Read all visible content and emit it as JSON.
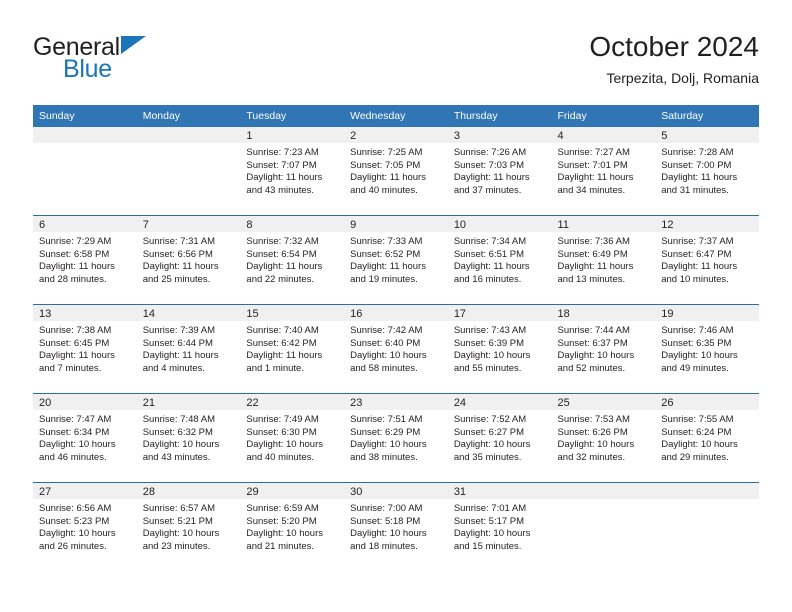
{
  "logo": {
    "word_top": "General",
    "word_bottom": "Blue",
    "accent_color": "#1b75bb"
  },
  "header": {
    "title": "October 2024",
    "subtitle": "Terpezita, Dolj, Romania"
  },
  "colors": {
    "header_band": "#3075b4",
    "row_divider": "#2e6da4",
    "daynum_band": "#f0f0f0",
    "text": "#231f20"
  },
  "calendar": {
    "weekday_headers": [
      "Sunday",
      "Monday",
      "Tuesday",
      "Wednesday",
      "Thursday",
      "Friday",
      "Saturday"
    ],
    "labels": {
      "sunrise": "Sunrise:",
      "sunset": "Sunset:",
      "daylight": "Daylight:"
    },
    "weeks": [
      [
        {
          "day": "",
          "lines": []
        },
        {
          "day": "",
          "lines": []
        },
        {
          "day": "1",
          "lines": [
            "Sunrise: 7:23 AM",
            "Sunset: 7:07 PM",
            "Daylight: 11 hours and 43 minutes."
          ]
        },
        {
          "day": "2",
          "lines": [
            "Sunrise: 7:25 AM",
            "Sunset: 7:05 PM",
            "Daylight: 11 hours and 40 minutes."
          ]
        },
        {
          "day": "3",
          "lines": [
            "Sunrise: 7:26 AM",
            "Sunset: 7:03 PM",
            "Daylight: 11 hours and 37 minutes."
          ]
        },
        {
          "day": "4",
          "lines": [
            "Sunrise: 7:27 AM",
            "Sunset: 7:01 PM",
            "Daylight: 11 hours and 34 minutes."
          ]
        },
        {
          "day": "5",
          "lines": [
            "Sunrise: 7:28 AM",
            "Sunset: 7:00 PM",
            "Daylight: 11 hours and 31 minutes."
          ]
        }
      ],
      [
        {
          "day": "6",
          "lines": [
            "Sunrise: 7:29 AM",
            "Sunset: 6:58 PM",
            "Daylight: 11 hours and 28 minutes."
          ]
        },
        {
          "day": "7",
          "lines": [
            "Sunrise: 7:31 AM",
            "Sunset: 6:56 PM",
            "Daylight: 11 hours and 25 minutes."
          ]
        },
        {
          "day": "8",
          "lines": [
            "Sunrise: 7:32 AM",
            "Sunset: 6:54 PM",
            "Daylight: 11 hours and 22 minutes."
          ]
        },
        {
          "day": "9",
          "lines": [
            "Sunrise: 7:33 AM",
            "Sunset: 6:52 PM",
            "Daylight: 11 hours and 19 minutes."
          ]
        },
        {
          "day": "10",
          "lines": [
            "Sunrise: 7:34 AM",
            "Sunset: 6:51 PM",
            "Daylight: 11 hours and 16 minutes."
          ]
        },
        {
          "day": "11",
          "lines": [
            "Sunrise: 7:36 AM",
            "Sunset: 6:49 PM",
            "Daylight: 11 hours and 13 minutes."
          ]
        },
        {
          "day": "12",
          "lines": [
            "Sunrise: 7:37 AM",
            "Sunset: 6:47 PM",
            "Daylight: 11 hours and 10 minutes."
          ]
        }
      ],
      [
        {
          "day": "13",
          "lines": [
            "Sunrise: 7:38 AM",
            "Sunset: 6:45 PM",
            "Daylight: 11 hours and 7 minutes."
          ]
        },
        {
          "day": "14",
          "lines": [
            "Sunrise: 7:39 AM",
            "Sunset: 6:44 PM",
            "Daylight: 11 hours and 4 minutes."
          ]
        },
        {
          "day": "15",
          "lines": [
            "Sunrise: 7:40 AM",
            "Sunset: 6:42 PM",
            "Daylight: 11 hours and 1 minute."
          ]
        },
        {
          "day": "16",
          "lines": [
            "Sunrise: 7:42 AM",
            "Sunset: 6:40 PM",
            "Daylight: 10 hours and 58 minutes."
          ]
        },
        {
          "day": "17",
          "lines": [
            "Sunrise: 7:43 AM",
            "Sunset: 6:39 PM",
            "Daylight: 10 hours and 55 minutes."
          ]
        },
        {
          "day": "18",
          "lines": [
            "Sunrise: 7:44 AM",
            "Sunset: 6:37 PM",
            "Daylight: 10 hours and 52 minutes."
          ]
        },
        {
          "day": "19",
          "lines": [
            "Sunrise: 7:46 AM",
            "Sunset: 6:35 PM",
            "Daylight: 10 hours and 49 minutes."
          ]
        }
      ],
      [
        {
          "day": "20",
          "lines": [
            "Sunrise: 7:47 AM",
            "Sunset: 6:34 PM",
            "Daylight: 10 hours and 46 minutes."
          ]
        },
        {
          "day": "21",
          "lines": [
            "Sunrise: 7:48 AM",
            "Sunset: 6:32 PM",
            "Daylight: 10 hours and 43 minutes."
          ]
        },
        {
          "day": "22",
          "lines": [
            "Sunrise: 7:49 AM",
            "Sunset: 6:30 PM",
            "Daylight: 10 hours and 40 minutes."
          ]
        },
        {
          "day": "23",
          "lines": [
            "Sunrise: 7:51 AM",
            "Sunset: 6:29 PM",
            "Daylight: 10 hours and 38 minutes."
          ]
        },
        {
          "day": "24",
          "lines": [
            "Sunrise: 7:52 AM",
            "Sunset: 6:27 PM",
            "Daylight: 10 hours and 35 minutes."
          ]
        },
        {
          "day": "25",
          "lines": [
            "Sunrise: 7:53 AM",
            "Sunset: 6:26 PM",
            "Daylight: 10 hours and 32 minutes."
          ]
        },
        {
          "day": "26",
          "lines": [
            "Sunrise: 7:55 AM",
            "Sunset: 6:24 PM",
            "Daylight: 10 hours and 29 minutes."
          ]
        }
      ],
      [
        {
          "day": "27",
          "lines": [
            "Sunrise: 6:56 AM",
            "Sunset: 5:23 PM",
            "Daylight: 10 hours and 26 minutes."
          ]
        },
        {
          "day": "28",
          "lines": [
            "Sunrise: 6:57 AM",
            "Sunset: 5:21 PM",
            "Daylight: 10 hours and 23 minutes."
          ]
        },
        {
          "day": "29",
          "lines": [
            "Sunrise: 6:59 AM",
            "Sunset: 5:20 PM",
            "Daylight: 10 hours and 21 minutes."
          ]
        },
        {
          "day": "30",
          "lines": [
            "Sunrise: 7:00 AM",
            "Sunset: 5:18 PM",
            "Daylight: 10 hours and 18 minutes."
          ]
        },
        {
          "day": "31",
          "lines": [
            "Sunrise: 7:01 AM",
            "Sunset: 5:17 PM",
            "Daylight: 10 hours and 15 minutes."
          ]
        },
        {
          "day": "",
          "lines": []
        },
        {
          "day": "",
          "lines": []
        }
      ]
    ]
  }
}
